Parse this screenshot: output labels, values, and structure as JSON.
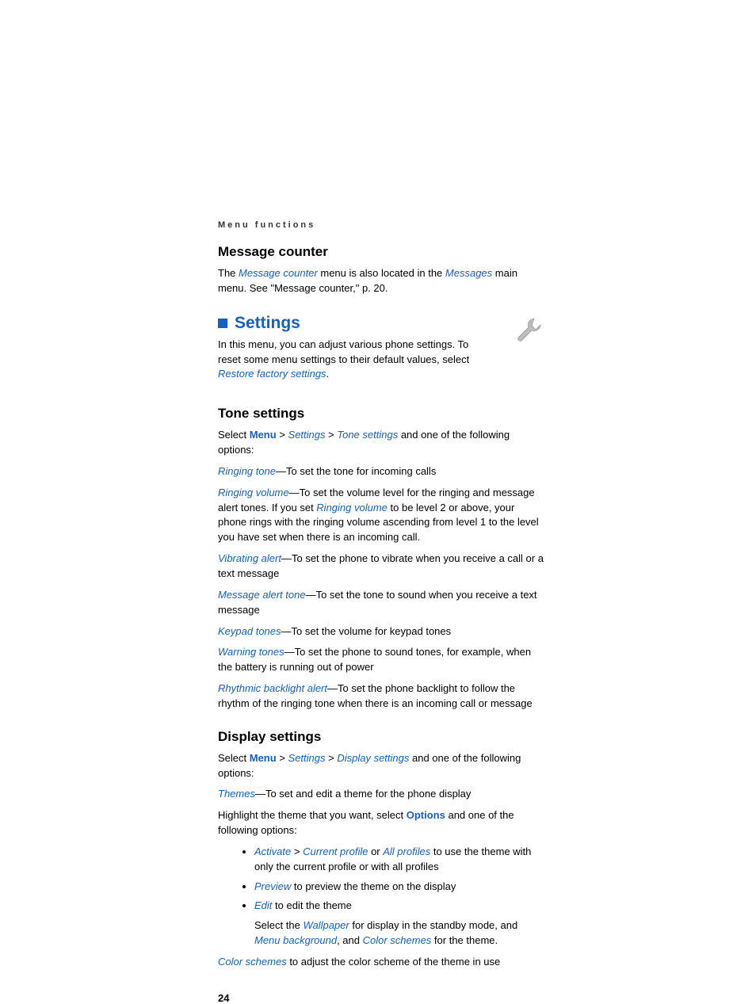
{
  "header": "Menu functions",
  "message_counter": {
    "title": "Message counter",
    "p1a": "The ",
    "link1": "Message counter",
    "p1b": " menu is also located in the ",
    "link2": "Messages",
    "p1c": " main menu. See \"Message counter,\" p. 20."
  },
  "settings": {
    "title": "Settings",
    "intro_a": "In this menu, you can adjust various phone settings. To reset some menu settings to their default values, select ",
    "intro_link": "Restore factory settings",
    "intro_b": "."
  },
  "tone": {
    "title": "Tone settings",
    "nav_a": "Select ",
    "nav_menu": "Menu",
    "nav_gt1": " > ",
    "nav_settings": "Settings",
    "nav_gt2": " > ",
    "nav_tone": "Tone settings",
    "nav_b": " and one of the following options:",
    "items": {
      "ringing_tone": {
        "label": "Ringing tone",
        "desc": "—To set the tone for incoming calls"
      },
      "ringing_volume": {
        "label": "Ringing volume",
        "desc_a": "—To set the volume level for the ringing and message alert tones. If you set ",
        "link": "Ringing volume",
        "desc_b": " to be level 2 or above, your phone rings with the ringing volume ascending from level 1 to the level you have set when there is an incoming call."
      },
      "vibrating": {
        "label": "Vibrating alert",
        "desc": "—To set the phone to vibrate when you receive a call or a text message"
      },
      "msg_alert": {
        "label": "Message alert tone",
        "desc": "—To set the tone to sound when you receive a text message"
      },
      "keypad": {
        "label": "Keypad tones",
        "desc": "—To set the volume for keypad tones"
      },
      "warning": {
        "label": "Warning tones",
        "desc": "—To set the phone to sound tones, for example, when the battery is running out of power"
      },
      "rhythmic": {
        "label": "Rhythmic backlight alert",
        "desc": "—To set the phone backlight to follow the rhythm of the ringing tone when there is an incoming call or message"
      }
    }
  },
  "display": {
    "title": "Display settings",
    "nav_a": "Select ",
    "nav_menu": "Menu",
    "nav_gt1": " > ",
    "nav_settings": "Settings",
    "nav_gt2": " > ",
    "nav_display": "Display settings",
    "nav_b": " and one of the following options:",
    "themes": {
      "label": "Themes",
      "desc": "—To set and edit a theme for the phone display"
    },
    "highlight_a": "Highlight the theme that you want, select ",
    "options": "Options",
    "highlight_b": " and one of the following options:",
    "bullets": {
      "activate": {
        "link1": "Activate",
        "gt": " > ",
        "link2": "Current profile",
        "or": " or ",
        "link3": "All profiles",
        "tail": " to use the theme with only the current profile or with all profiles"
      },
      "preview": {
        "link": "Preview",
        "tail": " to preview the theme on the display"
      },
      "edit": {
        "link": "Edit",
        "tail": " to edit the theme",
        "sub_a": "Select the ",
        "wallpaper": "Wallpaper",
        "sub_b": " for display in the standby mode, and ",
        "menubg": "Menu background",
        "sub_c": ", and ",
        "colorschemes": "Color schemes",
        "sub_d": "  for the theme."
      }
    },
    "color_schemes": {
      "label": "Color schemes",
      "desc": "  to adjust the color scheme of the theme in use"
    }
  },
  "page_number": "24"
}
